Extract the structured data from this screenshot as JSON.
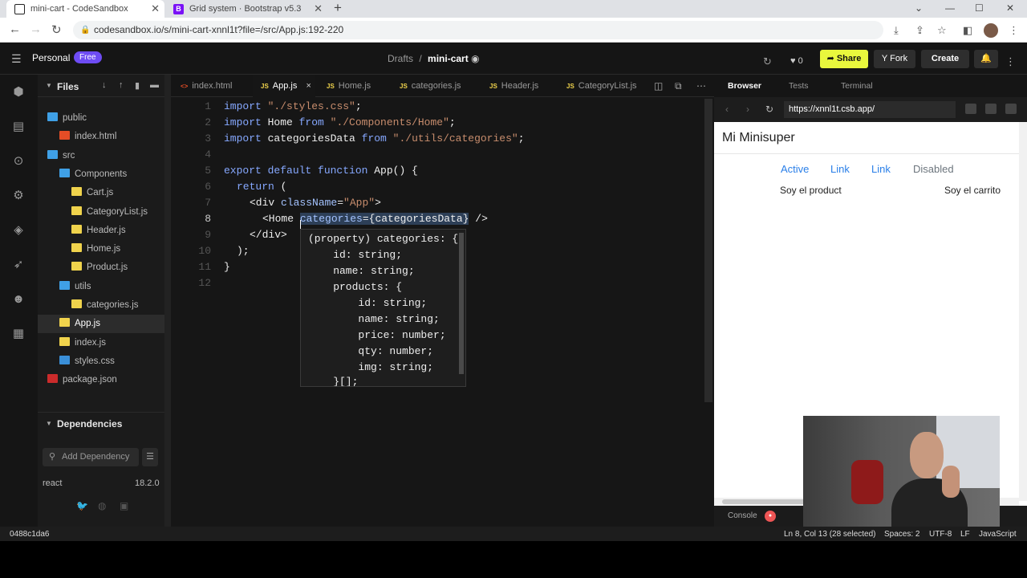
{
  "browser": {
    "tabs": [
      {
        "title": "mini-cart - CodeSandbox",
        "icon": "codesandbox-icon"
      },
      {
        "title": "Grid system · Bootstrap v5.3",
        "icon": "bootstrap-icon"
      }
    ],
    "url": "codesandbox.io/s/mini-cart-xnnl1t?file=/src/App.js:192-220",
    "new_tab": "+"
  },
  "app_header": {
    "workspace": "Personal",
    "plan_badge": "Free",
    "breadcrumb_parent": "Drafts",
    "breadcrumb_sep": "/",
    "sandbox_name": "mini-cart",
    "likes": "0",
    "share": "Share",
    "fork": "Fork",
    "create": "Create"
  },
  "sidebar": {
    "title": "Files",
    "tree": [
      {
        "name": "public",
        "type": "folder",
        "depth": 0
      },
      {
        "name": "index.html",
        "type": "html",
        "depth": 1
      },
      {
        "name": "src",
        "type": "folder",
        "depth": 0
      },
      {
        "name": "Components",
        "type": "folder",
        "depth": 1
      },
      {
        "name": "Cart.js",
        "type": "js",
        "depth": 2
      },
      {
        "name": "CategoryList.js",
        "type": "js",
        "depth": 2
      },
      {
        "name": "Header.js",
        "type": "js",
        "depth": 2
      },
      {
        "name": "Home.js",
        "type": "js",
        "depth": 2
      },
      {
        "name": "Product.js",
        "type": "js",
        "depth": 2
      },
      {
        "name": "utils",
        "type": "folder",
        "depth": 1
      },
      {
        "name": "categories.js",
        "type": "js",
        "depth": 2
      },
      {
        "name": "App.js",
        "type": "js",
        "depth": 1,
        "selected": true
      },
      {
        "name": "index.js",
        "type": "js",
        "depth": 1
      },
      {
        "name": "styles.css",
        "type": "css",
        "depth": 1
      },
      {
        "name": "package.json",
        "type": "pkg",
        "depth": 0
      }
    ],
    "dependencies": {
      "title": "Dependencies",
      "placeholder": "Add Dependency",
      "items": [
        {
          "name": "react",
          "version": "18.2.0"
        }
      ]
    }
  },
  "editor": {
    "tabs": [
      {
        "label": "index.html",
        "kind": "<>"
      },
      {
        "label": "App.js",
        "kind": "JS",
        "active": true,
        "close": "×"
      },
      {
        "label": "Home.js",
        "kind": "JS"
      },
      {
        "label": "categories.js",
        "kind": "JS"
      },
      {
        "label": "Header.js",
        "kind": "JS"
      },
      {
        "label": "CategoryList.js",
        "kind": "JS"
      }
    ],
    "line_numbers": [
      "1",
      "2",
      "3",
      "4",
      "5",
      "6",
      "7",
      "8",
      "9",
      "10",
      "11",
      "12"
    ],
    "code": {
      "l1_kw": "import",
      "l1_str": "\"./styles.css\"",
      "l1_end": ";",
      "l2_kw": "import",
      "l2_id": " Home ",
      "l2_from": "from",
      "l2_str": " \"./Components/Home\"",
      "l2_end": ";",
      "l3_kw": "import",
      "l3_id": " categoriesData ",
      "l3_from": "from",
      "l3_str": " \"./utils/categories\"",
      "l3_end": ";",
      "l5_kw": "export default function",
      "l5_rest": " App() {",
      "l6_kw": "return",
      "l6_rest": " (",
      "l7_open": "<div ",
      "l7_attr": "className",
      "l7_eq": "=",
      "l7_str": "\"App\"",
      "l7_close": ">",
      "l8_open": "<Home ",
      "l8_attr": "categories",
      "l8_eq": "=",
      "l8_val": "{categoriesData}",
      "l8_close": " />",
      "l9": "</div>",
      "l10": ");",
      "l11": "}"
    },
    "hover": [
      "(property) categories: {",
      "    id: string;",
      "    name: string;",
      "    products: {",
      "        id: string;",
      "        name: string;",
      "        price: number;",
      "        qty: number;",
      "        img: string;",
      "    }[];"
    ]
  },
  "preview": {
    "tabs": [
      "Browser",
      "Tests",
      "Terminal"
    ],
    "url": "https://xnnl1t.csb.app/",
    "page_title": "Mi Minisuper",
    "nav_links": [
      "Active",
      "Link",
      "Link",
      "Disabled"
    ],
    "left_text": "Soy el product",
    "right_text": "Soy el carrito",
    "console_label": "Console"
  },
  "status_bar": {
    "commit": "0488c1da6",
    "position": "Ln 8, Col 13 (28 selected)",
    "spaces": "Spaces: 2",
    "encoding": "UTF-8",
    "eol": "LF",
    "language": "JavaScript"
  },
  "colors": {
    "accent_yellow": "#e9f73d",
    "badge_purple": "#6e4cf4",
    "link_blue": "#2a7fe8"
  }
}
